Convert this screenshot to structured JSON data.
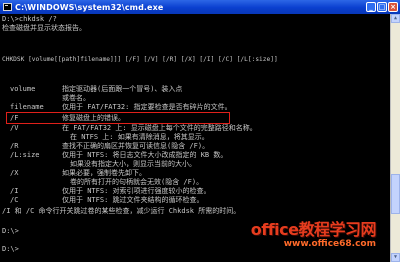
{
  "window": {
    "title": "C:\\WINDOWS\\system32\\cmd.exe",
    "buttons": {
      "minimize": "_",
      "maximize": "□",
      "close": "×"
    }
  },
  "console": {
    "lines": [
      "D:\\>chkdsk /?",
      "检查磁盘并显示状态报告。",
      "CHKDSK [volume[[path]filename]]] [/F] [/V] [/R] [/X] [/I] [/C] [/L[:size]]",
      "volume",
      "指定驱动器(后面跟一个冒号)、装入点",
      "或卷名。",
      "filename",
      "仅用于 FAT/FAT32: 指定要检查是否有碎片的文件。",
      "/F",
      "修复磁盘上的错误。",
      "/V",
      "在 FAT/FAT32 上: 显示磁盘上每个文件的完整路径和名称。",
      "在 NTFS 上: 如果有清除消息，将其显示。",
      "/R",
      "查找不正确的扇区并恢复可读信息(隐含 /F)。",
      "/L:size",
      "仅用于 NTFS: 将日志文件大小改成指定的 KB 数。",
      "如果没有指定大小，则显示当前的大小。",
      "/X",
      "如果必要，强制卷先卸下。",
      "卷的所有打开的句柄就会无效(隐含 /F)。",
      "/I",
      "仅用于 NTFS: 对索引项进行强度较小的检查。",
      "/C",
      "仅用于 NTFS: 跳过文件夹结构的循环检查。",
      "/I 和 /C 命令行开关跳过卷的某些检查，减少运行 Chkdsk 所需的时间。",
      "D:\\>",
      "D:\\>"
    ]
  },
  "watermark": {
    "brand": "office教程学习网",
    "url": "www.office68.com"
  },
  "colors": {
    "titlebar": "#0a3fcf",
    "console_bg": "#000000",
    "console_text": "#c8c8c8",
    "highlight": "#e0201a",
    "watermark": "#e63c1e"
  }
}
